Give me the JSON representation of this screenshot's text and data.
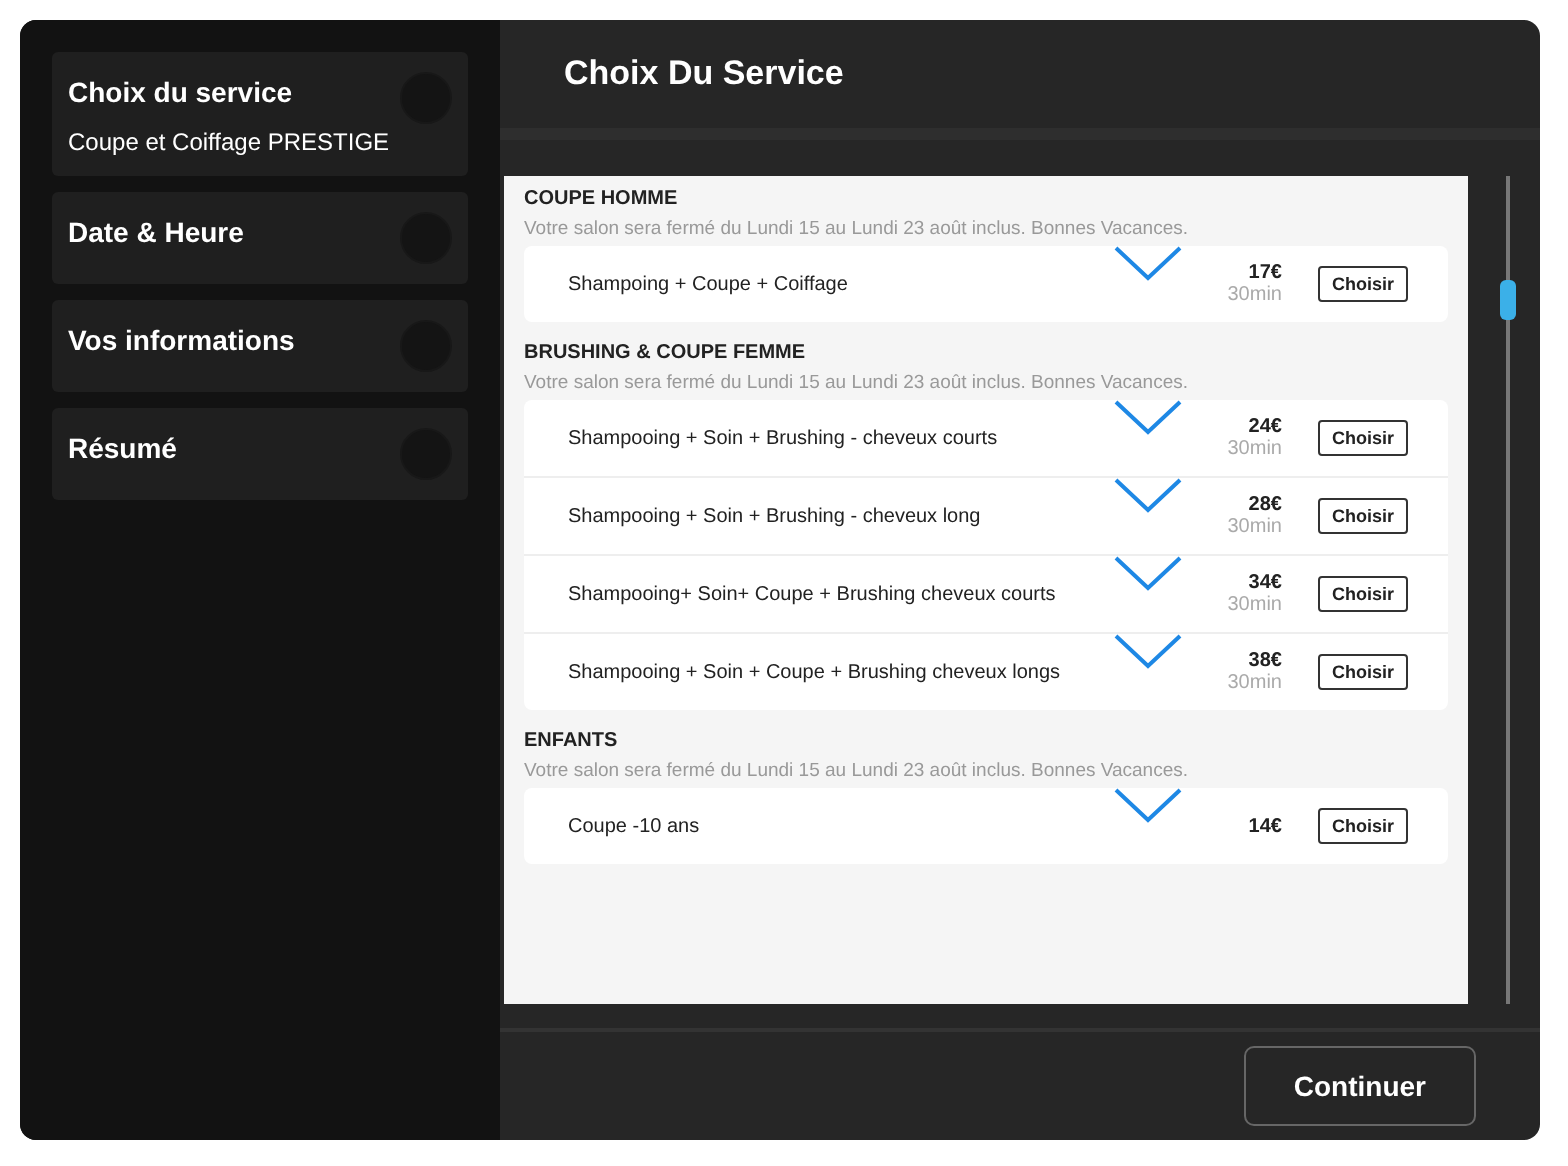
{
  "steps": [
    {
      "title": "Choix du service",
      "detail": "Coupe et Coiffage PRESTIGE"
    },
    {
      "title": "Date & Heure"
    },
    {
      "title": "Vos informations"
    },
    {
      "title": "Résumé"
    }
  ],
  "header": {
    "title": "Choix Du Service"
  },
  "sections": [
    {
      "title": "COUPE HOMME",
      "note": "Votre salon sera fermé du Lundi 15 au Lundi 23 août inclus. Bonnes Vacances.",
      "services": [
        {
          "name": "Shampoing + Coupe + Coiffage",
          "price": "17€",
          "duration": "30min",
          "action": "Choisir"
        }
      ]
    },
    {
      "title": "BRUSHING & COUPE FEMME",
      "note": "Votre salon sera fermé du Lundi 15 au Lundi 23 août inclus. Bonnes Vacances.",
      "services": [
        {
          "name": "Shampooing + Soin + Brushing - cheveux courts",
          "price": "24€",
          "duration": "30min",
          "action": "Choisir"
        },
        {
          "name": "Shampooing + Soin + Brushing - cheveux long",
          "price": "28€",
          "duration": "30min",
          "action": "Choisir"
        },
        {
          "name": "Shampooing+ Soin+ Coupe + Brushing cheveux courts",
          "price": "34€",
          "duration": "30min",
          "action": "Choisir"
        },
        {
          "name": "Shampooing + Soin + Coupe + Brushing cheveux longs",
          "price": "38€",
          "duration": "30min",
          "action": "Choisir"
        }
      ]
    },
    {
      "title": "ENFANTS",
      "note": "Votre salon sera fermé du Lundi 15 au Lundi 23 août inclus. Bonnes Vacances.",
      "services": [
        {
          "name": "Coupe -10 ans",
          "price": "14€",
          "action": "Choisir"
        }
      ]
    }
  ],
  "footer": {
    "button": "Continuer"
  }
}
